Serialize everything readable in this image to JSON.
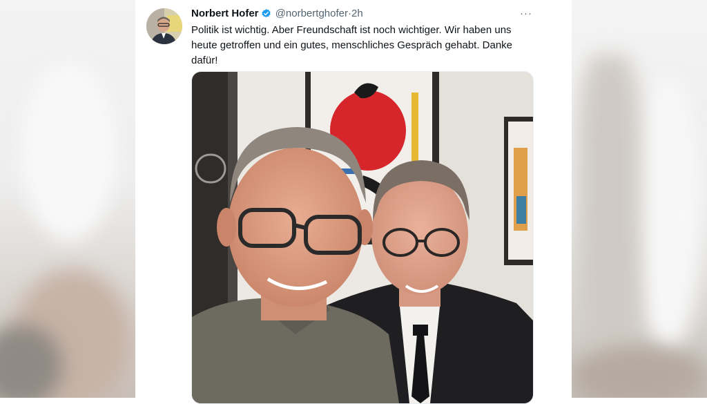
{
  "tweet": {
    "author_name": "Norbert Hofer",
    "handle": "@norbertghofer",
    "separator": "·",
    "time": "2h",
    "more_label": "···",
    "text_lines": [
      "Politik ist wichtig. Aber Freundschaft ist noch wichtiger. Wir haben uns",
      "heute getroffen  und ein gutes, menschliches Gespräch gehabt.  Danke",
      "dafür!"
    ]
  },
  "colors": {
    "verified_badge": "#1d9bf0",
    "handle_gray": "#536471",
    "text": "#0f1419"
  },
  "icons": {
    "verified": "verified-badge-icon",
    "more": "more-options-icon"
  }
}
